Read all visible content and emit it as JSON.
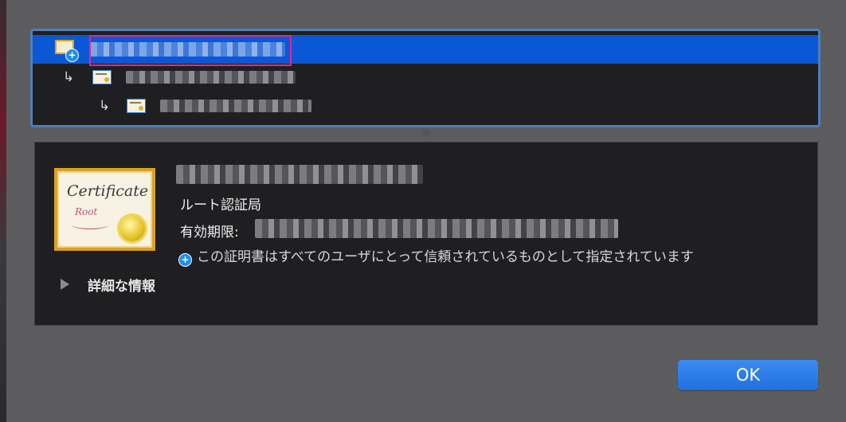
{
  "chain": {
    "root_arrow": "",
    "intermediate_arrow": "↳",
    "leaf_arrow": "↳"
  },
  "detail": {
    "cert_image_title": "Certificate",
    "cert_image_subtitle": "Root",
    "type": "ルート認証局",
    "expiry_label": "有効期限:",
    "trust_message": "この証明書はすべてのユーザにとって信頼されているものとして指定されています",
    "more_info": "詳細な情報"
  },
  "buttons": {
    "ok_label": "OK"
  },
  "colors": {
    "selection": "#0b58d6",
    "accent": "#1f6fe0",
    "highlight": "#e0278e"
  },
  "icons": {
    "root_cert": "root-certificate-icon",
    "cert": "certificate-icon",
    "trusted_badge": "plus-badge-icon",
    "disclosure": "disclosure-triangle-icon"
  }
}
